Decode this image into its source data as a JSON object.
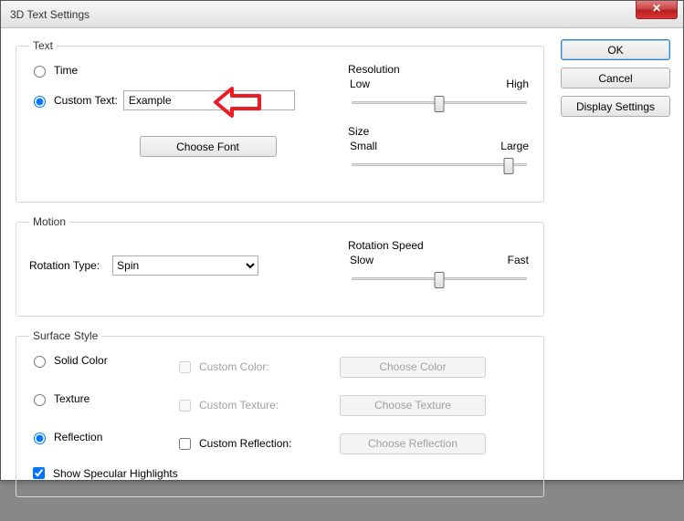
{
  "window": {
    "title": "3D Text Settings"
  },
  "text": {
    "legend": "Text",
    "time_label": "Time",
    "custom_text_label": "Custom Text:",
    "custom_text_value": "Example",
    "choose_font": "Choose Font",
    "resolution": {
      "title": "Resolution",
      "low": "Low",
      "high": "High"
    },
    "size": {
      "title": "Size",
      "small": "Small",
      "large": "Large"
    }
  },
  "motion": {
    "legend": "Motion",
    "rotation_type_label": "Rotation Type:",
    "rotation_type_value": "Spin",
    "speed": {
      "title": "Rotation Speed",
      "slow": "Slow",
      "fast": "Fast"
    }
  },
  "surface": {
    "legend": "Surface Style",
    "solid_color": "Solid Color",
    "texture": "Texture",
    "reflection": "Reflection",
    "custom_color": "Custom Color:",
    "custom_texture": "Custom Texture:",
    "custom_reflection": "Custom Reflection:",
    "choose_color": "Choose Color",
    "choose_texture": "Choose Texture",
    "choose_reflection": "Choose Reflection",
    "show_specular": "Show Specular Highlights"
  },
  "buttons": {
    "ok": "OK",
    "cancel": "Cancel",
    "display_settings": "Display Settings"
  },
  "annotation": {
    "arrow_color": "#ed1c24"
  }
}
